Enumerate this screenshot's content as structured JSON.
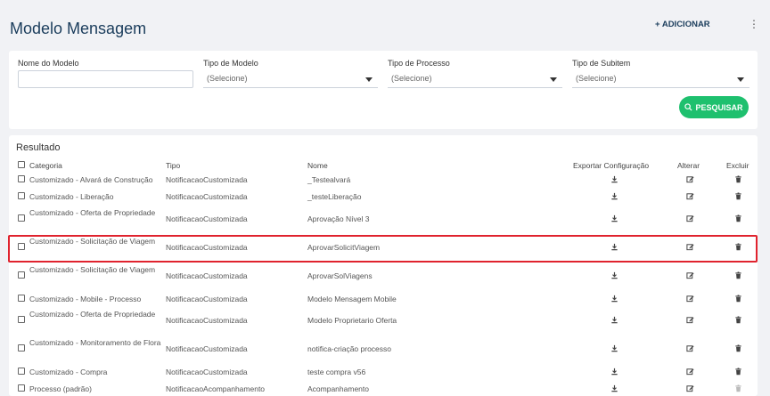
{
  "header": {
    "title": "Modelo Mensagem",
    "add_label": "+ ADICIONAR",
    "kebab_glyph": "⋮"
  },
  "filters": {
    "nome_label": "Nome do Modelo",
    "nome_value": "",
    "tipo_modelo_label": "Tipo de Modelo",
    "tipo_modelo_value": "(Selecione)",
    "tipo_processo_label": "Tipo de Processo",
    "tipo_processo_value": "(Selecione)",
    "tipo_subitem_label": "Tipo de Subitem",
    "tipo_subitem_value": "(Selecione)",
    "search_label": "PESQUISAR"
  },
  "results": {
    "title": "Resultado",
    "columns": {
      "categoria": "Categoria",
      "tipo": "Tipo",
      "nome": "Nome",
      "exportar": "Exportar Configuração",
      "alterar": "Alterar",
      "excluir": "Excluir"
    },
    "rows": [
      {
        "categoria": "Customizado - Alvará de Construção",
        "tipo": "NotificacaoCustomizada",
        "nome": "_Testealvará"
      },
      {
        "categoria": "Customizado - Liberação",
        "tipo": "NotificacaoCustomizada",
        "nome": "_testeLiberação"
      },
      {
        "categoria": "Customizado - Oferta de Propriedade",
        "tipo": "NotificacaoCustomizada",
        "nome": "Aprovação Nível 3"
      },
      {
        "categoria": "Customizado - Solicitação de Viagem",
        "tipo": "NotificacaoCustomizada",
        "nome": "AprovarSolicitViagem"
      },
      {
        "categoria": "Customizado - Solicitação de Viagem",
        "tipo": "NotificacaoCustomizada",
        "nome": "AprovarSolViagens"
      },
      {
        "categoria": "Customizado - Mobile - Processo",
        "tipo": "NotificacaoCustomizada",
        "nome": "Modelo Mensagem Mobile"
      },
      {
        "categoria": "Customizado - Oferta de Propriedade",
        "tipo": "NotificacaoCustomizada",
        "nome": "Modelo Proprietario Oferta"
      },
      {
        "categoria": "Customizado - Monitoramento de Flora",
        "tipo": "NotificacaoCustomizada",
        "nome": "notifica-criação processo"
      },
      {
        "categoria": "Customizado - Compra",
        "tipo": "NotificacaoCustomizada",
        "nome": "teste compra v56"
      },
      {
        "categoria": "Processo (padrão)",
        "tipo": "NotificacaoAcompanhamento",
        "nome": "Acompanhamento"
      }
    ]
  },
  "colors": {
    "title": "#1b3d5c",
    "search_button": "#1ec06e",
    "highlight": "#e0232e"
  }
}
